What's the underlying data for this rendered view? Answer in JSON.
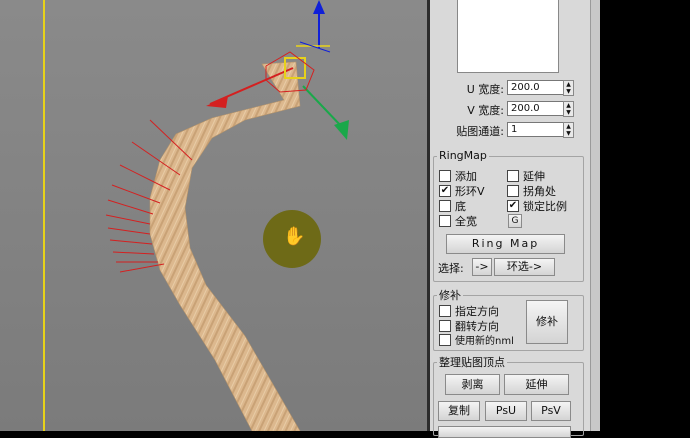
{
  "viewport": {
    "cursor_icon": "hand-pan-icon",
    "colors": {
      "border": "#e7d21a",
      "strip": "#d9b48a",
      "seam": "#d42020",
      "gizmo_x": "#d42020",
      "gizmo_y": "#1aa84a",
      "gizmo_z": "#1020d8"
    }
  },
  "panel": {
    "u_width": {
      "label": "U 宽度:",
      "value": "200.0"
    },
    "v_width": {
      "label": "V 宽度:",
      "value": "200.0"
    },
    "map_channel": {
      "label": "贴图通道:",
      "value": "1"
    },
    "ringmap": {
      "title": "RingMap",
      "checks": [
        {
          "label": "添加",
          "checked": false
        },
        {
          "label": "延伸",
          "checked": false
        },
        {
          "label": "形环V",
          "checked": true
        },
        {
          "label": "拐角处",
          "checked": false
        },
        {
          "label": "底",
          "checked": false
        },
        {
          "label": "锁定比例",
          "checked": true
        },
        {
          "label": "全宽",
          "checked": false
        }
      ],
      "g_button": "G",
      "ring_map_button": "Ring Map",
      "select_label": "选择:",
      "arrow_button": "->",
      "ring_select_button": "环选->"
    },
    "repair": {
      "title": "修补",
      "checks": [
        {
          "label": "指定方向",
          "checked": false
        },
        {
          "label": "翻转方向",
          "checked": false
        },
        {
          "label": "使用新的nml",
          "checked": false
        }
      ],
      "repair_button": "修补"
    },
    "arrange": {
      "title": "整理贴图顶点",
      "peel_button": "剥离",
      "extend_button": "延伸",
      "copy_button": "复制",
      "psu_button": "PsU",
      "psv_button": "PsV"
    }
  }
}
